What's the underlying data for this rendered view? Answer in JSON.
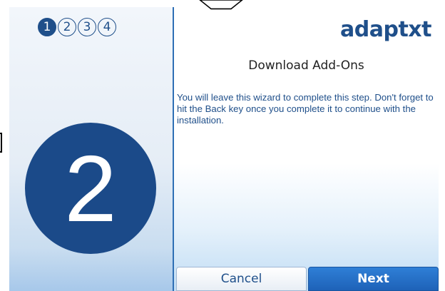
{
  "wizard": {
    "steps": [
      "1",
      "2",
      "3",
      "4"
    ],
    "active_step": 1,
    "current_step_display": "2"
  },
  "brand": {
    "logo_text": "adaptxt"
  },
  "content": {
    "title": "Download Add-Ons",
    "message": "You will leave this wizard to complete this step. Don't forget to hit the Back key once you complete it to continue with the installation."
  },
  "buttons": {
    "cancel_label": "Cancel",
    "next_label": "Next"
  },
  "colors": {
    "accent": "#1f4f8a",
    "next_button": "#2f7fd6",
    "divider": "#2e6fb5"
  },
  "icons": {
    "top": "chevron-down-icon"
  }
}
